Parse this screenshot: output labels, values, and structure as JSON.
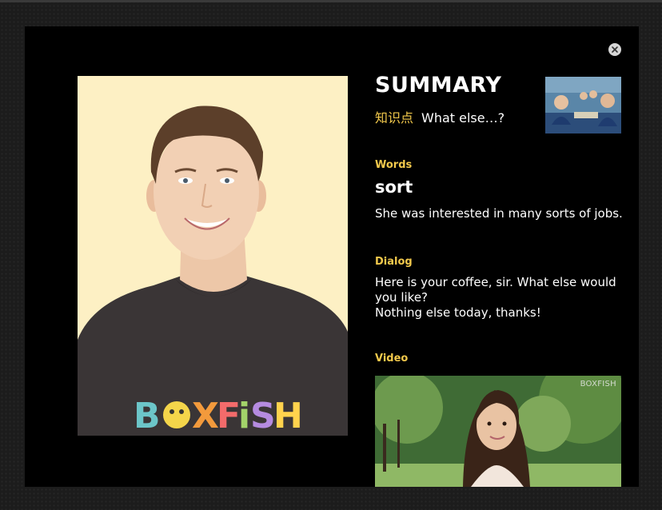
{
  "modal": {
    "close_icon": "close-icon"
  },
  "portrait": {
    "shirt_text": "BOXFISH",
    "shirt_letter_colors": [
      "#6cc6c9",
      "#f4d54a",
      "#f39a3c",
      "#f36b6b",
      "#a3d36a",
      "#b58be0",
      "#ffd34d"
    ]
  },
  "summary": {
    "title": "SUMMARY",
    "knowledge_label": "知识点",
    "subtitle": "What else…?"
  },
  "words": {
    "label": "Words",
    "word": "sort",
    "example": "She was interested in many sorts of jobs."
  },
  "dialog": {
    "label": "Dialog",
    "lines": [
      "Here is your coffee, sir. What else would you like?",
      "Nothing else today, thanks!"
    ]
  },
  "video": {
    "label": "Video",
    "watermark": "BOXFISH"
  },
  "colors": {
    "accent": "#f2c94c",
    "modal_bg": "#000000",
    "portrait_bg": "#fdf0c4"
  }
}
